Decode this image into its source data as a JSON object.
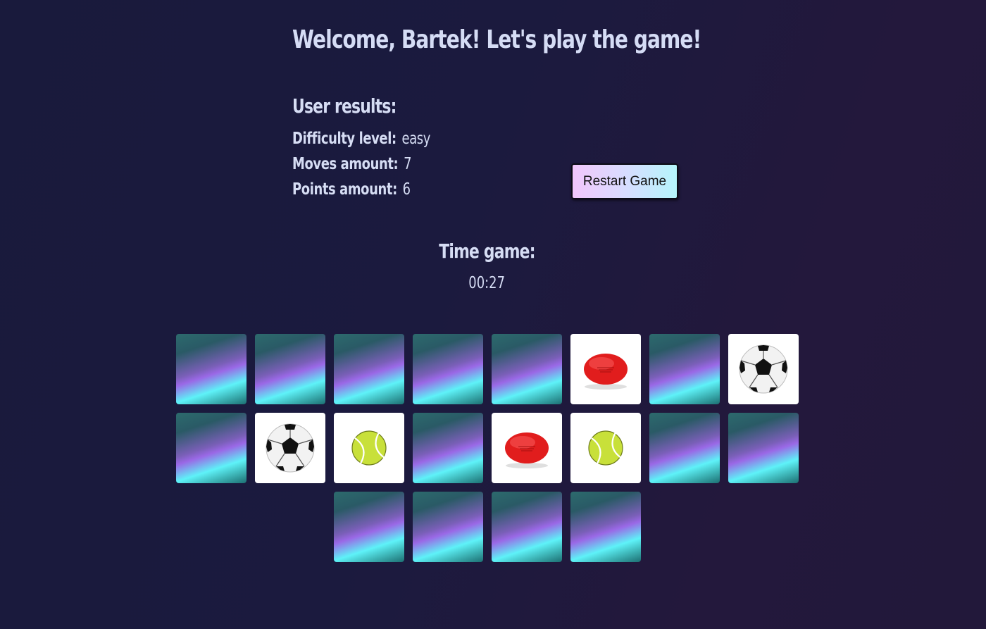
{
  "header": {
    "title": "Welcome, Bartek! Let's play the game!"
  },
  "results": {
    "heading": "User results:",
    "difficulty_label": "Difficulty level:",
    "difficulty_value": "easy",
    "moves_label": "Moves amount:",
    "moves_value": "7",
    "points_label": "Points amount:",
    "points_value": "6"
  },
  "controls": {
    "restart_label": "Restart Game"
  },
  "timer": {
    "heading": "Time game:",
    "value": "00:27"
  },
  "board": {
    "rows": [
      [
        "hidden",
        "hidden",
        "hidden",
        "hidden",
        "hidden",
        "rugby-ball",
        "hidden",
        "soccer-ball"
      ],
      [
        "hidden",
        "soccer-ball",
        "tennis-ball",
        "hidden",
        "rugby-ball",
        "tennis-ball",
        "hidden",
        "hidden"
      ],
      [
        "hidden",
        "hidden",
        "hidden",
        "hidden"
      ]
    ]
  },
  "colors": {
    "background": "#1b1a3e",
    "text": "#d6ddf4",
    "card_front": "#ffffff",
    "rugby_ball": "#e11d1d",
    "tennis_ball": "#c8e03a"
  }
}
